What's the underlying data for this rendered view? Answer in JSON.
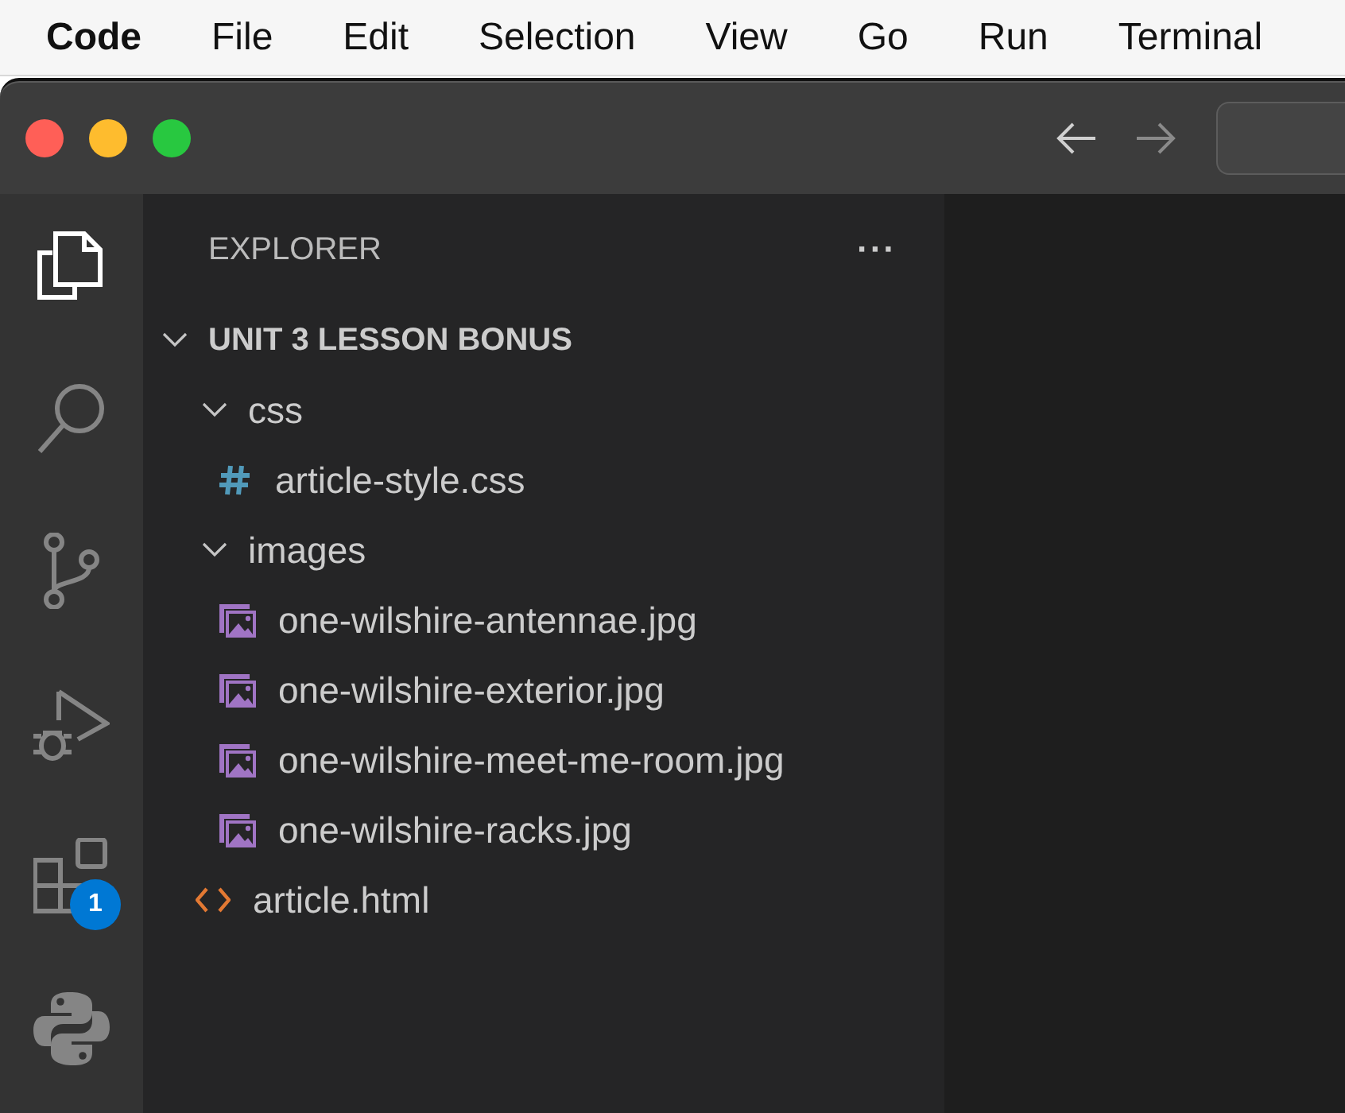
{
  "menu_bar": [
    {
      "label": "Code",
      "kind": "app"
    },
    {
      "label": "File",
      "kind": "menu"
    },
    {
      "label": "Edit",
      "kind": "menu"
    },
    {
      "label": "Selection",
      "kind": "menu"
    },
    {
      "label": "View",
      "kind": "menu"
    },
    {
      "label": "Go",
      "kind": "menu"
    },
    {
      "label": "Run",
      "kind": "menu"
    },
    {
      "label": "Terminal",
      "kind": "menu"
    }
  ],
  "title_bar": {
    "navigation": [
      {
        "kind": "back",
        "disabled": false
      },
      {
        "kind": "forward",
        "disabled": true
      }
    ]
  },
  "activity_bar": [
    {
      "kind": "explorer",
      "selected": true
    },
    {
      "kind": "search",
      "selected": false
    },
    {
      "kind": "source-control",
      "selected": false
    },
    {
      "kind": "run-debug",
      "selected": false
    },
    {
      "kind": "extensions",
      "selected": false,
      "badge": "1"
    },
    {
      "kind": "python",
      "selected": false
    }
  ],
  "sidebar": {
    "title": "EXPLORER",
    "more": "···",
    "root": {
      "label": "UNIT 3 LESSON BONUS",
      "expanded": true,
      "children": [
        {
          "kind": "folder",
          "label": "css",
          "expanded": true,
          "children": [
            {
              "kind": "css",
              "label": "article-style.css"
            }
          ]
        },
        {
          "kind": "folder",
          "label": "images",
          "expanded": true,
          "children": [
            {
              "kind": "image",
              "label": "one-wilshire-antennae.jpg"
            },
            {
              "kind": "image",
              "label": "one-wilshire-exterior.jpg"
            },
            {
              "kind": "image",
              "label": "one-wilshire-meet-me-room.jpg"
            },
            {
              "kind": "image",
              "label": "one-wilshire-racks.jpg"
            }
          ]
        },
        {
          "kind": "html",
          "label": "article.html"
        }
      ]
    }
  }
}
